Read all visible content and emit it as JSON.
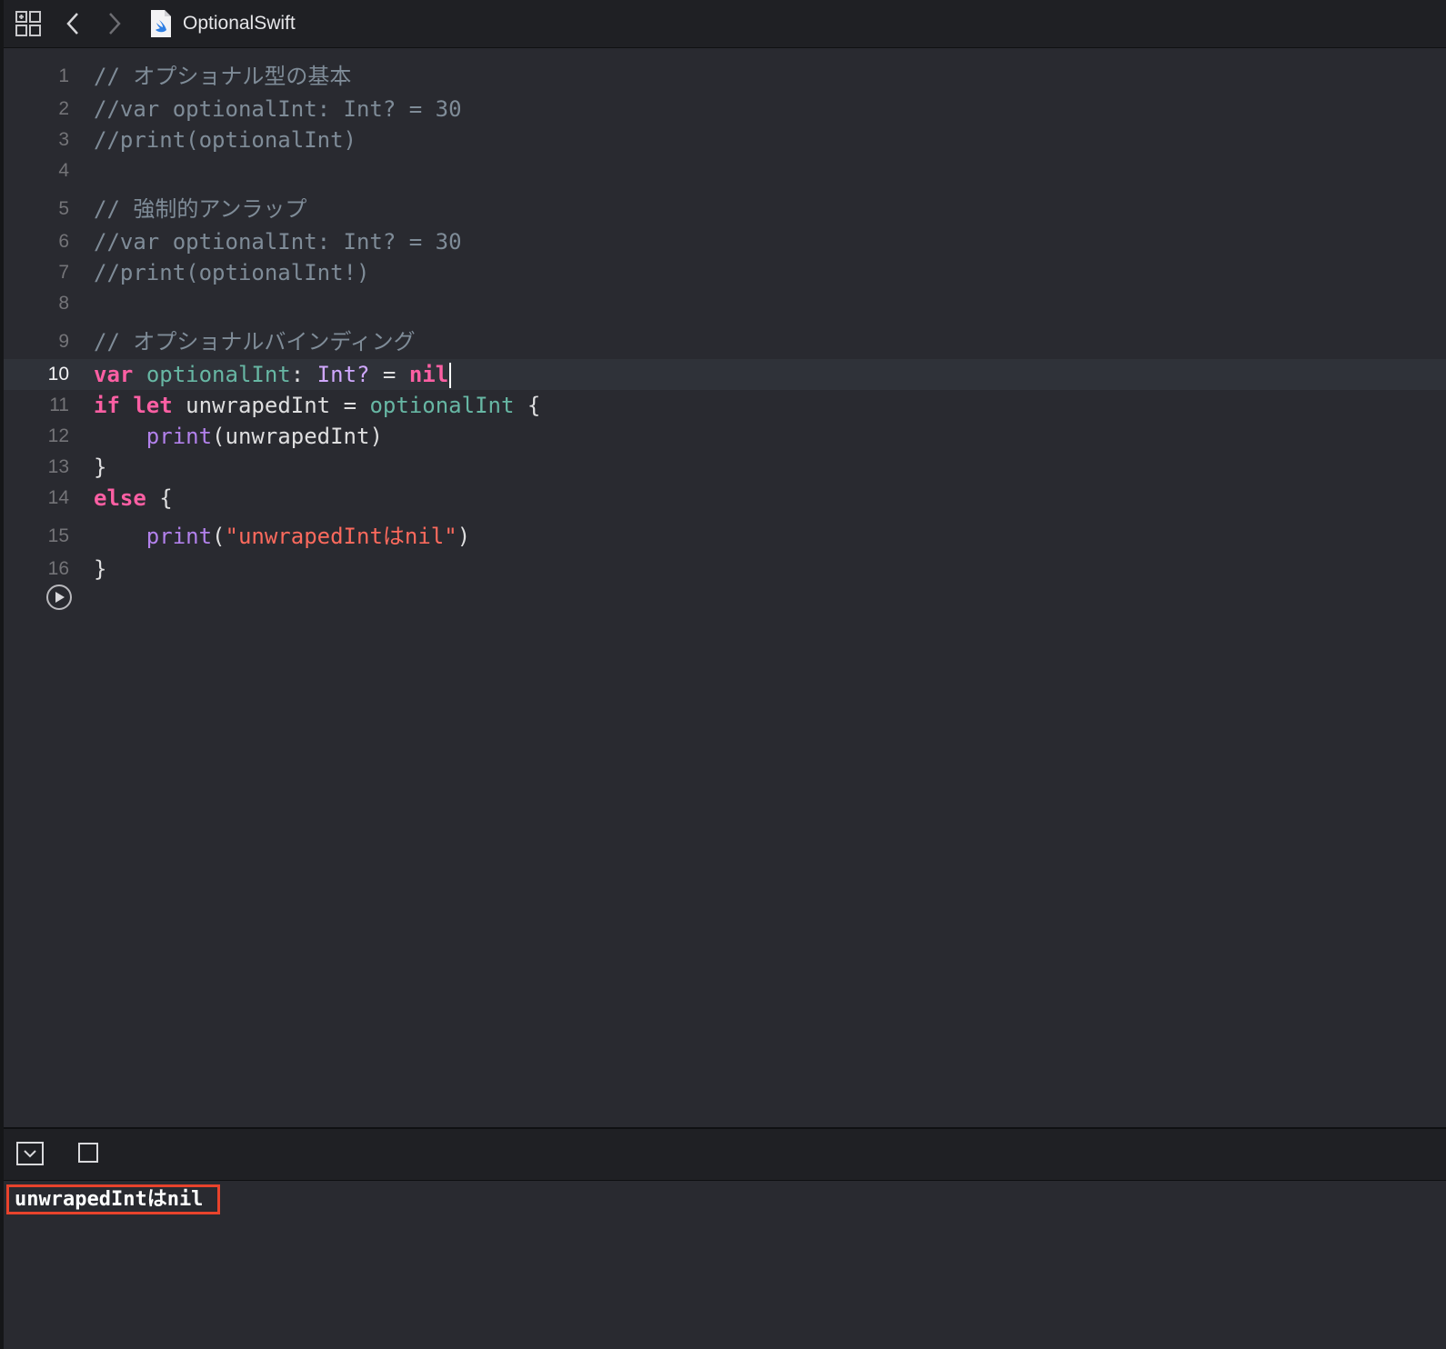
{
  "titlebar": {
    "file_name": "OptionalSwift",
    "icons": [
      "grid-icon",
      "chevron-left-icon",
      "chevron-right-icon",
      "swift-file-icon"
    ]
  },
  "editor": {
    "current_line": 10,
    "lines": [
      {
        "n": "1",
        "text": "// オプショナル型の基本"
      },
      {
        "n": "2",
        "text": "//var optionalInt: Int? = 30"
      },
      {
        "n": "3",
        "text": "//print(optionalInt)"
      },
      {
        "n": "4",
        "text": ""
      },
      {
        "n": "5",
        "text": "// 強制的アンラップ"
      },
      {
        "n": "6",
        "text": "//var optionalInt: Int? = 30"
      },
      {
        "n": "7",
        "text": "//print(optionalInt!)"
      },
      {
        "n": "8",
        "text": ""
      },
      {
        "n": "9",
        "text": "// オプショナルバインディング"
      },
      {
        "n": "10",
        "tokens": [
          "var",
          "optionalInt",
          ":",
          "Int?",
          "=",
          "nil"
        ]
      },
      {
        "n": "11",
        "tokens": [
          "if",
          "let",
          "unwrapedInt",
          "=",
          "optionalInt",
          "{"
        ]
      },
      {
        "n": "12",
        "tokens": [
          "print",
          "(unwrapedInt)"
        ]
      },
      {
        "n": "13",
        "text": "}"
      },
      {
        "n": "14",
        "tokens": [
          "else",
          "{"
        ]
      },
      {
        "n": "15",
        "tokens": [
          "print",
          "(",
          "\"unwrapedIntはnil\"",
          ")"
        ]
      },
      {
        "n": "16",
        "text": "}"
      }
    ]
  },
  "debug": {
    "console_output": "unwrapedIntはnil",
    "highlight_color": "#e8432c"
  },
  "colors": {
    "background": "#292a30",
    "keyword": "#fc5fa3",
    "comment": "#7f8c98",
    "string": "#fc6a5d",
    "type": "#d0a8ff",
    "function": "#b281eb",
    "variable": "#67b7a4"
  }
}
